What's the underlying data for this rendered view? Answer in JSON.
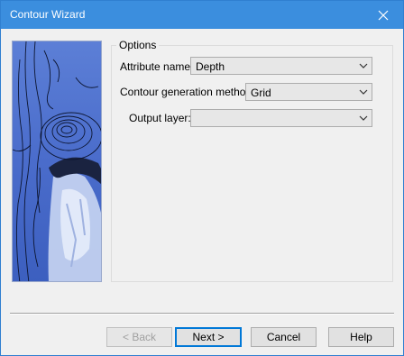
{
  "window": {
    "title": "Contour Wizard"
  },
  "options": {
    "group_label": "Options",
    "attribute_name": {
      "label": "Attribute name:",
      "value": "Depth"
    },
    "method": {
      "label": "Contour generation method:",
      "value": "Grid"
    },
    "output_layer": {
      "label": "Output layer:",
      "value": ""
    }
  },
  "buttons": {
    "back": "< Back",
    "next": "Next >",
    "cancel": "Cancel",
    "help": "Help"
  },
  "colors": {
    "titlebar": "#3b8ede",
    "image_blue": "#4a6fc9",
    "default_button_border": "#0078d7"
  },
  "icons": {
    "close": "close-icon",
    "dropdown": "chevron-down-icon"
  }
}
